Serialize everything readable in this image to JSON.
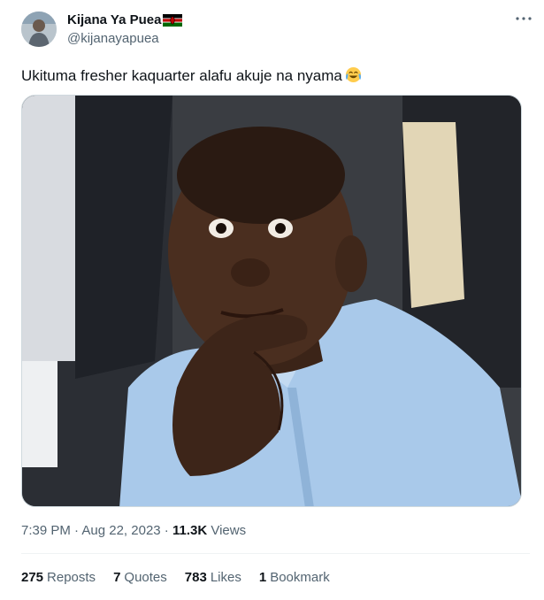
{
  "author": {
    "name": "Kijana Ya Puea",
    "handle": "@kijanayapuea"
  },
  "tweet": {
    "text": "Ukituma fresher kaquarter alafu akuje na nyama",
    "emoji": "face-with-tears-of-joy-emoji"
  },
  "meta": {
    "time": "7:39 PM",
    "separator1": " · ",
    "date": "Aug 22, 2023",
    "separator2": " · ",
    "views_count": "11.3K",
    "views_label": "Views"
  },
  "stats": {
    "reposts_count": "275",
    "reposts_label": "Reposts",
    "quotes_count": "7",
    "quotes_label": "Quotes",
    "likes_count": "783",
    "likes_label": "Likes",
    "bookmarks_count": "1",
    "bookmarks_label": "Bookmark"
  },
  "colors": {
    "text": "#0f1419",
    "secondary": "#536471",
    "divider": "#eff3f4"
  }
}
